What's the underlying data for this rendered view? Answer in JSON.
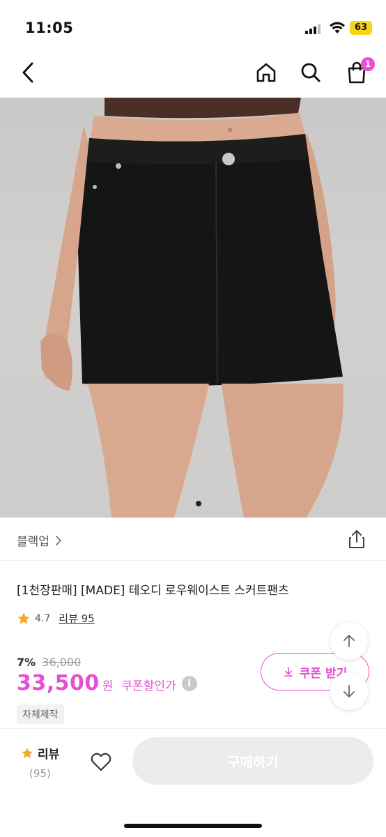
{
  "status_bar": {
    "time": "11:05",
    "battery": "63"
  },
  "nav": {
    "cart_count": "1",
    "back_icon": "chevron-left-icon",
    "home_icon": "home-icon",
    "search_icon": "search-icon",
    "cart_icon": "shopping-bag-icon"
  },
  "product": {
    "brand": "블랙업",
    "title": "[1천장판매] [MADE] 테오디 로우웨이스트 스커트팬츠",
    "rating": "4.7",
    "review_link": "리뷰 95",
    "discount_rate": "7%",
    "original_price": "36,000",
    "price": "33,500",
    "currency": "원",
    "coupon_label": "쿠폰할인가",
    "coupon_button": "쿠폰 받기",
    "tag": "자체제작"
  },
  "colors": {
    "accent": "#e64fd3",
    "star": "#f5a623"
  },
  "bottom": {
    "review_label": "리뷰",
    "review_count": "(95)",
    "buy_label": "구매하기"
  }
}
